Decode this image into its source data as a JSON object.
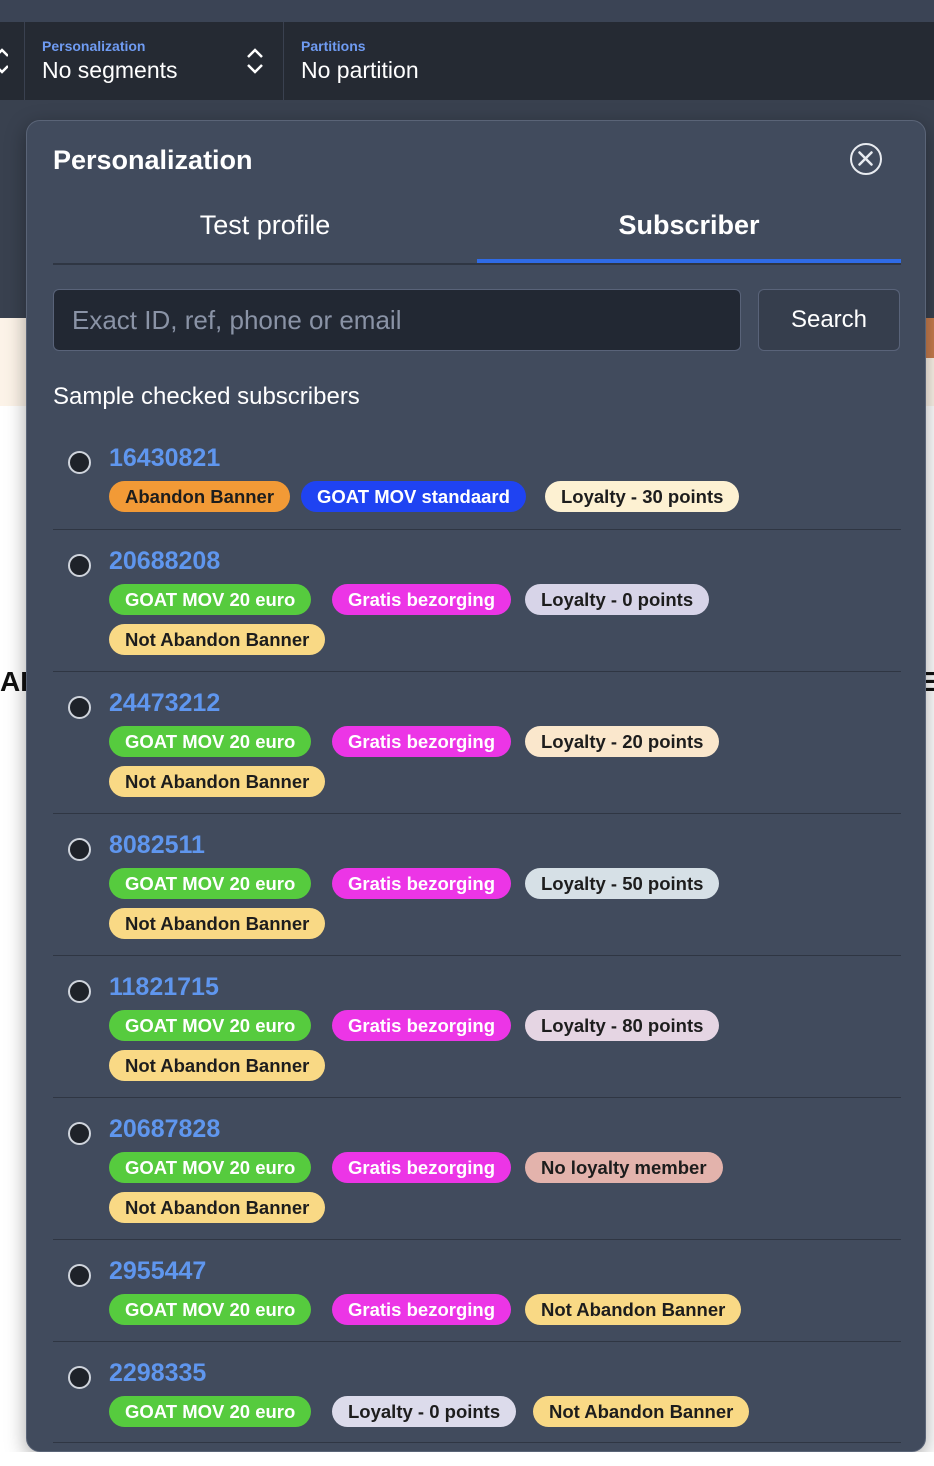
{
  "toolbar": {
    "personalization_label": "Personalization",
    "personalization_value": "No segments",
    "partitions_label": "Partitions",
    "partitions_value": "No partition"
  },
  "background": {
    "left_text": "AF",
    "right_text": "E"
  },
  "modal": {
    "title": "Personalization",
    "tabs": [
      {
        "label": "Test profile",
        "active": false
      },
      {
        "label": "Subscriber",
        "active": true
      }
    ],
    "search": {
      "placeholder": "Exact ID, ref, phone or email",
      "value": "",
      "button_label": "Search"
    },
    "section_heading": "Sample checked subscribers",
    "subscribers": [
      {
        "id": "16430821",
        "tags": [
          "Abandon Banner",
          "GOAT MOV standaard",
          "Loyalty - 30 points"
        ]
      },
      {
        "id": "20688208",
        "tags": [
          "GOAT MOV 20 euro",
          "Gratis bezorging",
          "Loyalty - 0 points",
          "Not Abandon Banner"
        ]
      },
      {
        "id": "24473212",
        "tags": [
          "GOAT MOV 20 euro",
          "Gratis bezorging",
          "Loyalty - 20 points",
          "Not Abandon Banner"
        ]
      },
      {
        "id": "8082511",
        "tags": [
          "GOAT MOV 20 euro",
          "Gratis bezorging",
          "Loyalty - 50 points",
          "Not Abandon Banner"
        ]
      },
      {
        "id": "11821715",
        "tags": [
          "GOAT MOV 20 euro",
          "Gratis bezorging",
          "Loyalty - 80 points",
          "Not Abandon Banner"
        ]
      },
      {
        "id": "20687828",
        "tags": [
          "GOAT MOV 20 euro",
          "Gratis bezorging",
          "No loyalty member",
          "Not Abandon Banner"
        ]
      },
      {
        "id": "2955447",
        "tags": [
          "GOAT MOV 20 euro",
          "Gratis bezorging",
          "Not Abandon Banner"
        ]
      },
      {
        "id": "2298335",
        "tags": [
          "GOAT MOV 20 euro",
          "Loyalty - 0 points",
          "Not Abandon Banner"
        ]
      }
    ]
  },
  "colors": {
    "accent_blue": "#2f6be6",
    "link_blue": "#5f96ee",
    "tag_orange": "#f29a36",
    "tag_blue": "#1f43f2",
    "tag_green": "#56cb3e",
    "tag_magenta": "#ec35e6",
    "tag_yellow": "#f9d985"
  },
  "icons": {
    "close": "close-circle-icon",
    "updown": "chevron-up-down-icon",
    "radio": "radio-unselected-icon"
  }
}
